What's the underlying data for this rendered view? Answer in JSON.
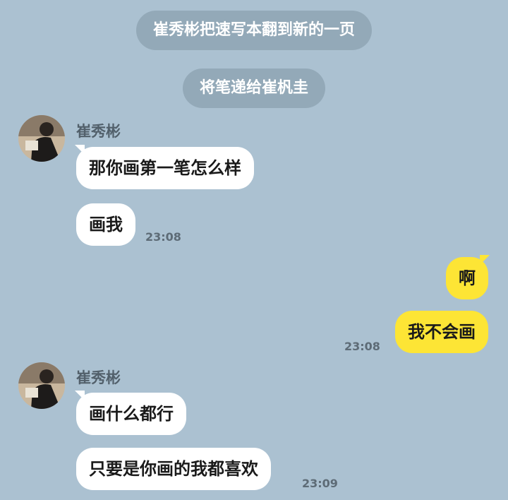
{
  "system_messages": [
    "崔秀彬把速写本翻到新的一页",
    "将笔递给崔杋圭"
  ],
  "groups": [
    {
      "sender": "崔秀彬",
      "avatar_icon": "user-photo-avatar",
      "messages": [
        {
          "text": "那你画第一笔怎么样"
        },
        {
          "text": "画我",
          "time": "23:08"
        }
      ]
    },
    {
      "sender": "崔秀彬",
      "avatar_icon": "user-photo-avatar",
      "messages": [
        {
          "text": "画什么都行"
        },
        {
          "text": "只要是你画的我都喜欢",
          "time": "23:09"
        }
      ]
    }
  ],
  "outgoing": {
    "messages": [
      {
        "text": "啊"
      },
      {
        "text": "我不会画",
        "time": "23:08"
      }
    ]
  },
  "colors": {
    "background": "#abc1d1",
    "system_pill": "#93a9b8",
    "incoming_bubble": "#ffffff",
    "outgoing_bubble": "#fde535"
  }
}
